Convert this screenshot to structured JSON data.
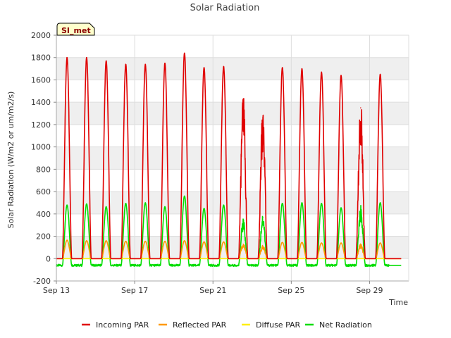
{
  "chart_data": {
    "type": "line",
    "title": "Solar Radiation",
    "xlabel": "Time",
    "ylabel": "Solar Radiation (W/m2 or um/m2/s)",
    "ylim": [
      -200,
      2000
    ],
    "yticks": [
      -200,
      0,
      200,
      400,
      600,
      800,
      1000,
      1200,
      1400,
      1600,
      1800,
      2000
    ],
    "xlim": [
      "2023-09-13",
      "2023-10-01"
    ],
    "xticks": [
      {
        "date": "2023-09-13",
        "label": "Sep 13"
      },
      {
        "date": "2023-09-17",
        "label": "Sep 17"
      },
      {
        "date": "2023-09-21",
        "label": "Sep 21"
      },
      {
        "date": "2023-09-25",
        "label": "Sep 25"
      },
      {
        "date": "2023-09-29",
        "label": "Sep 29"
      }
    ],
    "x_start_date": "2023-09-13",
    "grid": true,
    "legend_position": "bottom",
    "site_badge": "SI_met",
    "days": [
      "2023-09-13",
      "2023-09-14",
      "2023-09-15",
      "2023-09-16",
      "2023-09-17",
      "2023-09-18",
      "2023-09-19",
      "2023-09-20",
      "2023-09-21",
      "2023-09-22",
      "2023-09-23",
      "2023-09-24",
      "2023-09-25",
      "2023-09-26",
      "2023-09-27",
      "2023-09-28",
      "2023-09-29",
      "2023-09-30"
    ],
    "series": [
      {
        "name": "Incoming PAR",
        "color": "#e00000",
        "daily_peak": [
          1800,
          1800,
          1770,
          1740,
          1740,
          1750,
          1840,
          1710,
          1720,
          1430,
          1260,
          1710,
          1700,
          1670,
          1640,
          1350,
          1650,
          null
        ]
      },
      {
        "name": "Reflected PAR",
        "color": "#ff9900",
        "daily_peak": [
          165,
          160,
          160,
          155,
          155,
          155,
          160,
          150,
          150,
          130,
          110,
          145,
          145,
          140,
          140,
          120,
          140,
          null
        ]
      },
      {
        "name": "Diffuse PAR",
        "color": "#ffee00",
        "daily_peak": [
          null,
          null,
          null,
          null,
          null,
          null,
          null,
          null,
          null,
          null,
          null,
          null,
          null,
          null,
          null,
          null,
          null,
          null
        ]
      },
      {
        "name": "Net Radiation",
        "color": "#00dd00",
        "daily_peak": [
          480,
          490,
          465,
          495,
          500,
          465,
          560,
          450,
          480,
          330,
          370,
          495,
          500,
          495,
          455,
          440,
          500,
          null
        ],
        "night_value": -60
      }
    ]
  }
}
